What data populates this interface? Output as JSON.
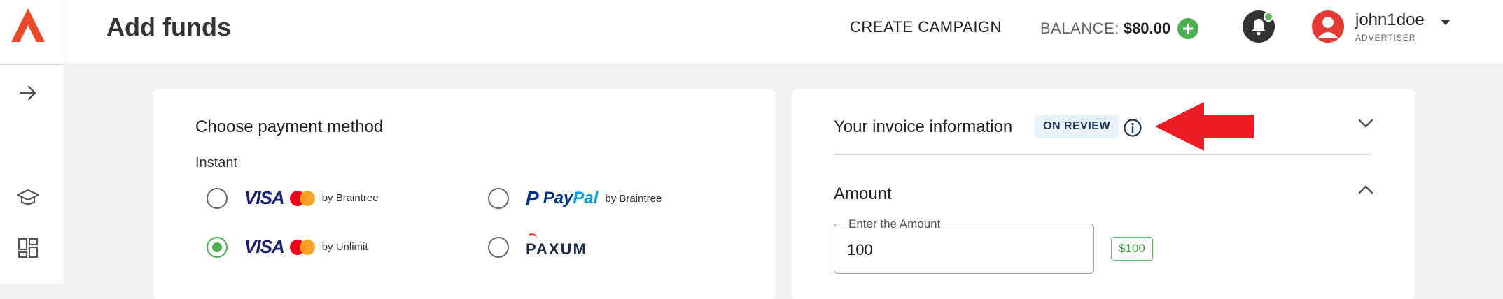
{
  "header": {
    "title": "Add funds",
    "create_campaign": "CREATE CAMPAIGN",
    "balance_label": "BALANCE:",
    "balance_value": "$80.00",
    "add_symbol": "+"
  },
  "user": {
    "name": "john1doe",
    "role": "ADVERTISER"
  },
  "payment": {
    "title": "Choose payment method",
    "section": "Instant",
    "options": [
      {
        "brand": "VISA",
        "provider": "by Braintree",
        "selected": false
      },
      {
        "brand": "PayPal",
        "provider": "by Braintree",
        "selected": false
      },
      {
        "brand": "VISA",
        "provider": "by Unlimit",
        "selected": true
      },
      {
        "brand": "PAXUM",
        "provider": "",
        "selected": false
      }
    ]
  },
  "invoice": {
    "title": "Your invoice information",
    "status": "ON REVIEW"
  },
  "amount": {
    "title": "Amount",
    "field_label": "Enter the Amount",
    "value": "100",
    "chip": "$100"
  },
  "brand_text": {
    "pay": "Pay",
    "pal": "Pal",
    "p": "P"
  },
  "colors": {
    "brand": "#e84a27",
    "accent_green": "#4caf50",
    "arrow_red": "#ed1c24"
  },
  "icons": [
    "logo",
    "arrow-right-icon",
    "graduation-cap-icon",
    "dashboard-icon",
    "bell-icon",
    "avatar-icon",
    "caret-down-icon",
    "info-icon",
    "chevron-down-icon",
    "chevron-up-icon"
  ]
}
